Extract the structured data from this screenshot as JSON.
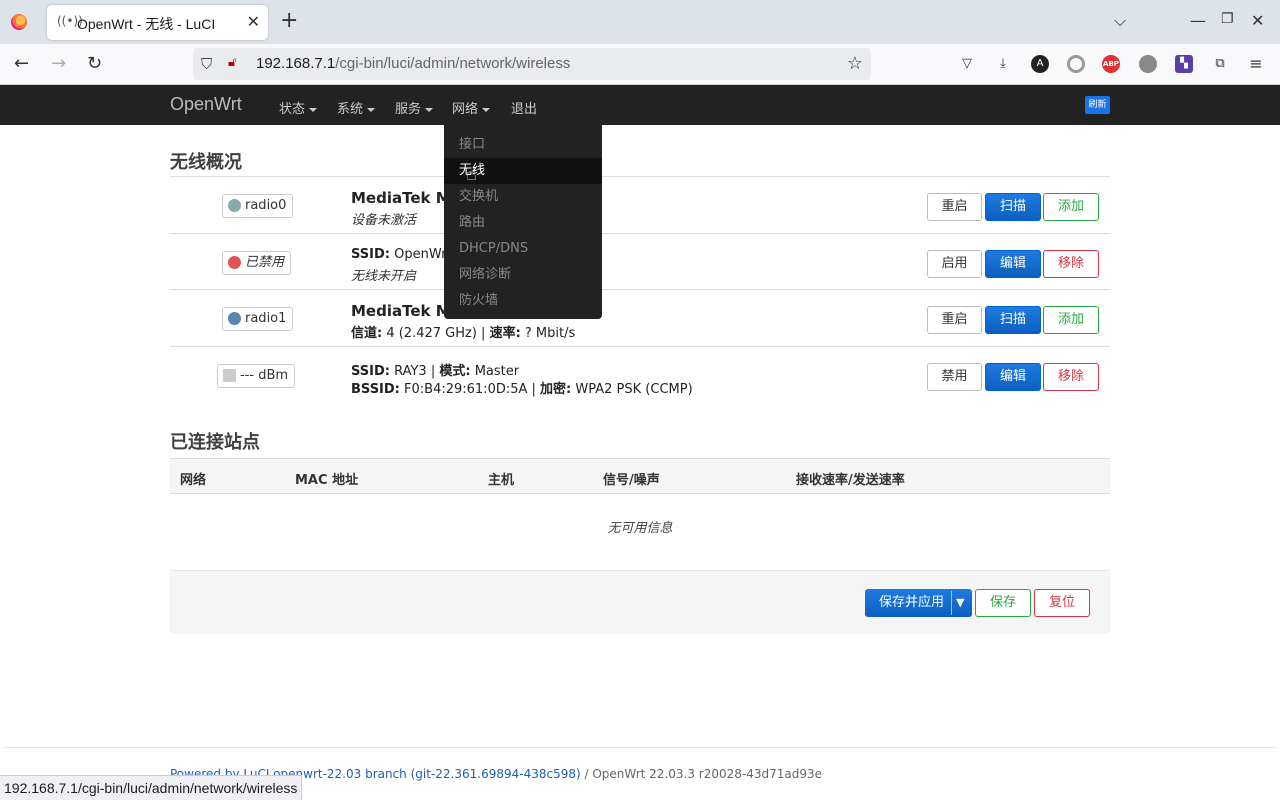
{
  "browser": {
    "tab_title": "OpenWrt - 无线 - LuCI",
    "url_host": "192.168.7.1",
    "url_path": "/cgi-bin/luci/admin/network/wireless",
    "status_url": "192.168.7.1/cgi-bin/luci/admin/network/wireless"
  },
  "luci": {
    "brand": "OpenWrt",
    "menu": [
      "状态",
      "系统",
      "服务",
      "网络",
      "退出"
    ],
    "refresh_badge": "刷新",
    "dropdown": [
      "接口",
      "无线",
      "交换机",
      "路由",
      "DHCP/DNS",
      "网络诊断",
      "防火墙"
    ]
  },
  "wireless": {
    "heading": "无线概况",
    "rows": [
      {
        "badge": "radio0",
        "title": "MediaTek MT",
        "sub": "设备未激活",
        "buttons": [
          "重启",
          "扫描",
          "添加"
        ]
      },
      {
        "badge": "已禁用",
        "line1_label": "SSID:",
        "line1_value": " OpenWrt",
        "sub": "无线未开启",
        "buttons": [
          "启用",
          "编辑",
          "移除"
        ]
      },
      {
        "badge": "radio1",
        "title": "MediaTek MT",
        "line_label1": "信道:",
        "line_value1": " 4 (2.427 GHz) | ",
        "line_label2": "速率:",
        "line_value2": " ? Mbit/s",
        "buttons": [
          "重启",
          "扫描",
          "添加"
        ]
      },
      {
        "badge": "--- dBm",
        "l1_label1": "SSID:",
        "l1_value1": " RAY3 | ",
        "l1_label2": "模式:",
        "l1_value2": " Master",
        "l2_label1": "BSSID:",
        "l2_value1": " F0:B4:29:61:0D:5A | ",
        "l2_label2": "加密:",
        "l2_value2": " WPA2 PSK (CCMP)",
        "buttons": [
          "禁用",
          "编辑",
          "移除"
        ]
      }
    ]
  },
  "stations": {
    "heading": "已连接站点",
    "columns": [
      "网络",
      "MAC 地址",
      "主机",
      "信号/噪声",
      "接收速率/发送速率"
    ],
    "empty": "无可用信息"
  },
  "actions": {
    "save_apply": "保存并应用",
    "save": "保存",
    "reset": "复位"
  },
  "footer": {
    "link_text": "Powered by LuCI openwrt-22.03 branch (git-22.361.69894-438c598)",
    "version": " / OpenWrt 22.03.3 r20028-43d71ad93e"
  }
}
